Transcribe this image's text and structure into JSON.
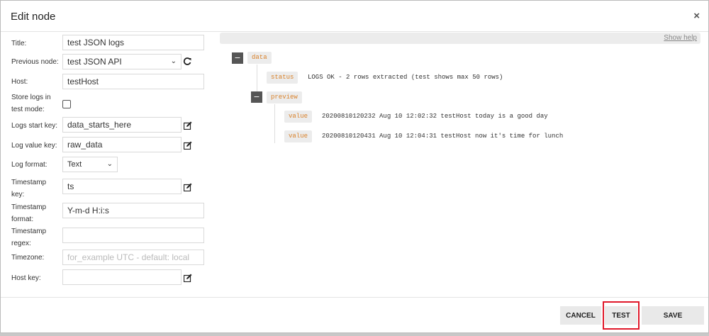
{
  "dialog": {
    "title": "Edit node",
    "close_glyph": "×"
  },
  "form": {
    "title_label": "Title:",
    "title_value": "test JSON logs",
    "prev_node_label": "Previous node:",
    "prev_node_value": "test JSON API",
    "host_label": "Host:",
    "host_value": "testHost",
    "store_logs_label": "Store logs in test mode:",
    "store_logs_checked": false,
    "logs_start_key_label": "Logs start key:",
    "logs_start_key_value": "data_starts_here",
    "log_value_key_label": "Log value key:",
    "log_value_key_value": "raw_data",
    "log_format_label": "Log format:",
    "log_format_value": "Text",
    "timestamp_key_label": "Timestamp key:",
    "timestamp_key_value": "ts",
    "timestamp_format_label": "Timestamp format:",
    "timestamp_format_value": "Y-m-d H:i:s",
    "timestamp_regex_label": "Timestamp regex:",
    "timestamp_regex_value": "",
    "timezone_label": "Timezone:",
    "timezone_placeholder": "for_example UTC - default: local",
    "host_key_label": "Host key:",
    "host_key_value": ""
  },
  "help": {
    "link_label": "Show help"
  },
  "tree": {
    "root_key": "data",
    "status_key": "status",
    "status_value": "LOGS OK - 2 rows extracted (test shows max 50 rows)",
    "preview_key": "preview",
    "rows": [
      {
        "key": "value",
        "value": "20200810120232 Aug 10 12:02:32 testHost today is a good day"
      },
      {
        "key": "value",
        "value": "20200810120431 Aug 10 12:04:31 testHost now it's time for lunch"
      }
    ],
    "toggle_glyph": "−"
  },
  "footer": {
    "cancel_label": "CANCEL",
    "test_label": "TEST",
    "save_label": "SAVE"
  },
  "colors": {
    "key_text": "#d9822b",
    "highlight": "#e0182a",
    "toggle_bg": "#555555"
  }
}
